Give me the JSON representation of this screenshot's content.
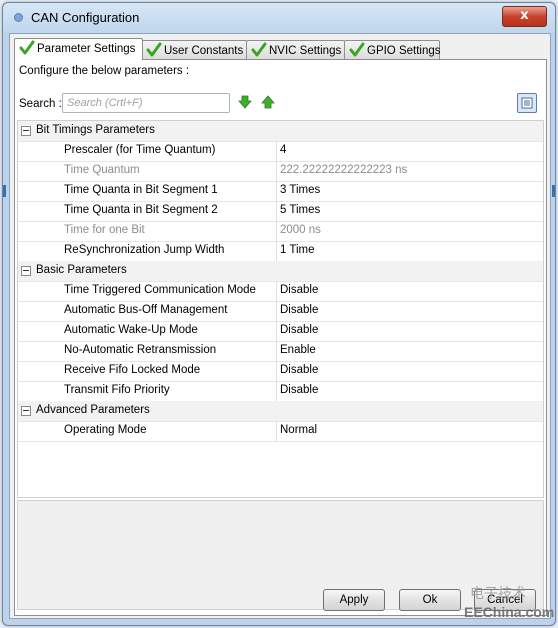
{
  "window": {
    "title": "CAN Configuration",
    "close_label": "x"
  },
  "tabs": [
    {
      "label": "Parameter Settings",
      "active": true
    },
    {
      "label": "User Constants",
      "active": false
    },
    {
      "label": "NVIC Settings",
      "active": false
    },
    {
      "label": "GPIO Settings",
      "active": false
    }
  ],
  "panel": {
    "configure_text": "Configure the below parameters :",
    "search_label": "Search :",
    "search_placeholder": "Search (Crtl+F)"
  },
  "groups": [
    {
      "label": "Bit Timings Parameters",
      "rows": [
        {
          "name": "Prescaler (for Time Quantum)",
          "value": "4",
          "disabled": false
        },
        {
          "name": "Time Quantum",
          "value": "222.22222222222223 ns",
          "disabled": true
        },
        {
          "name": "Time Quanta in Bit Segment 1",
          "value": "3 Times",
          "disabled": false
        },
        {
          "name": "Time Quanta in Bit Segment 2",
          "value": "5 Times",
          "disabled": false
        },
        {
          "name": "Time for one Bit",
          "value": "2000 ns",
          "disabled": true
        },
        {
          "name": "ReSynchronization Jump Width",
          "value": "1 Time",
          "disabled": false
        }
      ]
    },
    {
      "label": "Basic Parameters",
      "rows": [
        {
          "name": "Time Triggered Communication Mode",
          "value": "Disable",
          "disabled": false
        },
        {
          "name": "Automatic Bus-Off Management",
          "value": "Disable",
          "disabled": false
        },
        {
          "name": "Automatic Wake-Up Mode",
          "value": "Disable",
          "disabled": false
        },
        {
          "name": "No-Automatic Retransmission",
          "value": "Enable",
          "disabled": false
        },
        {
          "name": "Receive Fifo Locked Mode",
          "value": "Disable",
          "disabled": false
        },
        {
          "name": "Transmit Fifo Priority",
          "value": "Disable",
          "disabled": false
        }
      ]
    },
    {
      "label": "Advanced Parameters",
      "rows": [
        {
          "name": "Operating Mode",
          "value": "Normal",
          "disabled": false
        }
      ]
    }
  ],
  "buttons": {
    "apply": "Apply",
    "ok": "Ok",
    "cancel": "Cancel"
  },
  "watermark": {
    "cn": "电子技术",
    "en": "EEChina.com"
  },
  "colors": {
    "check": "#3aa524",
    "arrow": "#3fae2a",
    "disabled_text": "#8c8c8c"
  }
}
